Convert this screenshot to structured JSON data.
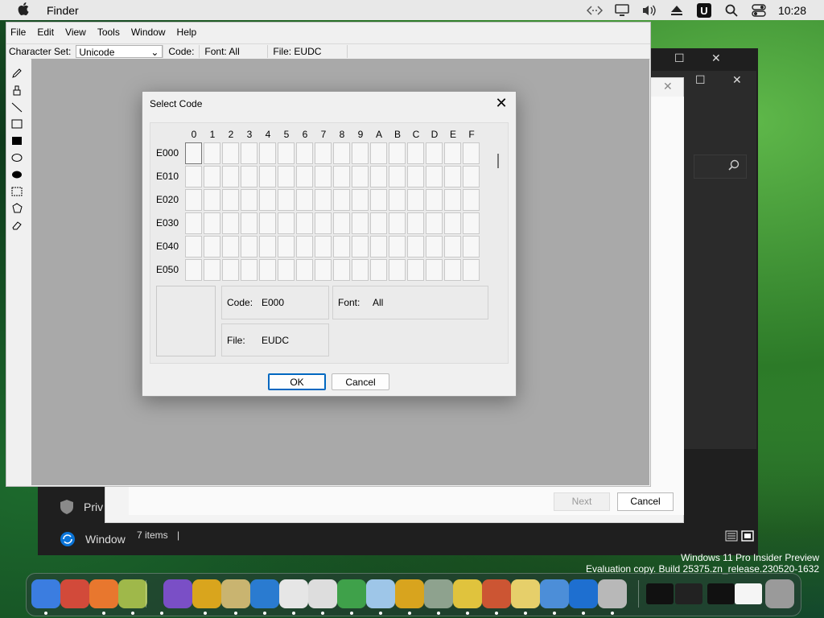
{
  "menubar": {
    "app_name": "Finder",
    "clock": "10:28",
    "icons": [
      "apple-icon",
      "code-icon",
      "display-icon",
      "volume-icon",
      "eject-icon",
      "u-icon",
      "search-icon",
      "control-center-icon"
    ]
  },
  "editor": {
    "menu": [
      "File",
      "Edit",
      "View",
      "Tools",
      "Window",
      "Help"
    ],
    "toolbar": {
      "charset_label": "Character Set:",
      "charset_value": "Unicode",
      "code_label": "Code:",
      "font_field": "Font: All",
      "file_field": "File: EUDC"
    },
    "tools": [
      "pencil-icon",
      "brush-icon",
      "line-icon",
      "hollow-rectangle-icon",
      "filled-rectangle-icon",
      "hollow-ellipse-icon",
      "filled-ellipse-icon",
      "rect-select-icon",
      "freeform-select-icon",
      "eraser-icon"
    ]
  },
  "dialog": {
    "title": "Select Code",
    "columns": [
      "0",
      "1",
      "2",
      "3",
      "4",
      "5",
      "6",
      "7",
      "8",
      "9",
      "A",
      "B",
      "C",
      "D",
      "E",
      "F"
    ],
    "rows": [
      "E000",
      "E010",
      "E020",
      "E030",
      "E040",
      "E050"
    ],
    "selected_cell": {
      "row": 0,
      "col": 0
    },
    "code_label": "Code:",
    "code_value": "E000",
    "font_label": "Font:",
    "font_value": "All",
    "file_label": "File:",
    "file_value": "EUDC",
    "ok_label": "OK",
    "cancel_label": "Cancel"
  },
  "background": {
    "next_label": "Next",
    "cancel_label": "Cancel",
    "status_text": "7 items",
    "sidebar_item_1": "Priv",
    "sidebar_item_2": "Window"
  },
  "watermark": {
    "line1": "Windows 11 Pro Insider Preview",
    "line2": "Evaluation copy. Build 25375.zn_release.230520-1632"
  },
  "dock": {
    "apps": [
      "finder-icon",
      "launchpad-icon",
      "firefox-icon",
      "text-editor-icon",
      "visual-studio-icon",
      "chrome-icon",
      "keychain-icon",
      "app-store-icon",
      "terminal-icon",
      "scanner-icon",
      "network-icon",
      "gallery-icon",
      "magnifier-icon",
      "installer-icon",
      "paint-icon",
      "toolbox-icon",
      "notes-check-icon",
      "alpha-icon",
      "bluetooth-icon",
      "archive-icon",
      "window-thumb-1",
      "window-thumb-2",
      "window-thumb-3",
      "window-thumb-4",
      "trash-icon"
    ]
  },
  "colors": {
    "accent": "#0067c0",
    "canvas": "#a9a9a9",
    "dialog_bg": "#f0f0f0"
  }
}
